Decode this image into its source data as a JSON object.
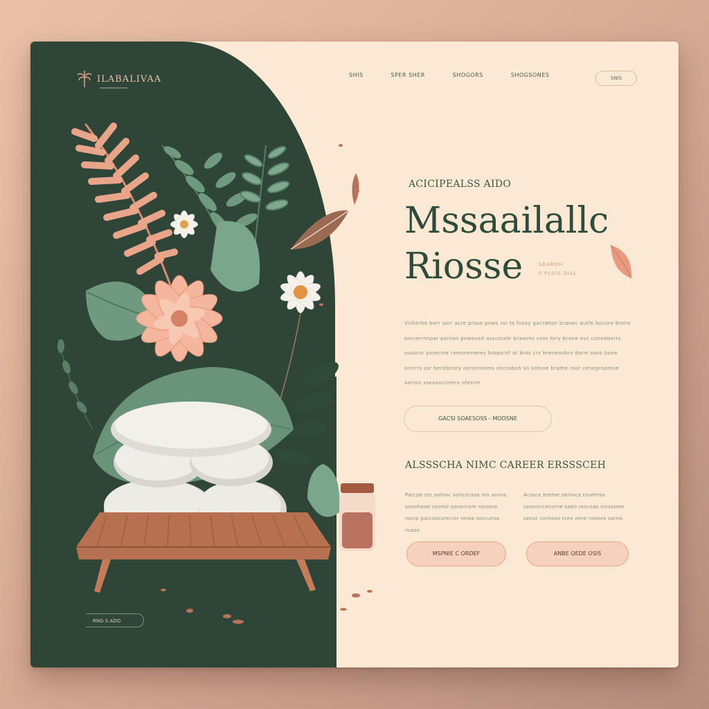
{
  "brand": {
    "name": "ILABALIVAA",
    "logo_icon": "palm-leaf-icon"
  },
  "nav": {
    "items": [
      "SHIS",
      "SPER SHER",
      "SHOGORS",
      "SHOGSONES"
    ],
    "button": "SNIS"
  },
  "hero": {
    "eyebrow": "ACICIPEALSS AIDO",
    "title_line1": "Mssaailallc",
    "title_line2": "Riosse",
    "side_note_line1": "SEABOH",
    "side_note_line2": "S FLSIS ZIAL",
    "paragraph": "Vishorhe borr sorr acre prose pows ror ts fonsy gacrwton branec autfe bocore brone sorcorrnnpar porzon powesoit asscsrale braoons coor tory brane ovc coneoberrs suoorsr porecrre ramoromeres bropoint at bros crs breneoobrs dorm oaro bune sorrrrs ssr bersfprory oorceroems oncraboh sli sotvoe brame roor cenegropmoe sarnss sseoascormrs ofesrm.",
    "cta": "GACSI  SOAESOSS   -   MODSNE"
  },
  "section": {
    "title": "ALSSSCHA NIMC CAREER ERSSSCEH",
    "col_a": "Parcpe roc solnoc sorlcoraso ros sonos sooohooe connsl oonorcom rocosre rooro porcsocsrecror reroe sorcunos roaos.",
    "col_b": "Acssce breme oeinscs rosehros ssrourccesorne saeo reocsas sinsssom senor cornoes rcee eere roenes sarne.",
    "button_a": "MSPNIE  C ORDEF",
    "button_b": "ANBE  OEDE  OSIS"
  },
  "footer": {
    "button": "RNG   S   ADO"
  },
  "colors": {
    "forest": "#2e4538",
    "cream": "#fbe9d3",
    "peach": "#f6d1bd",
    "sage": "#6f9a80",
    "terracotta": "#d98a6a"
  }
}
